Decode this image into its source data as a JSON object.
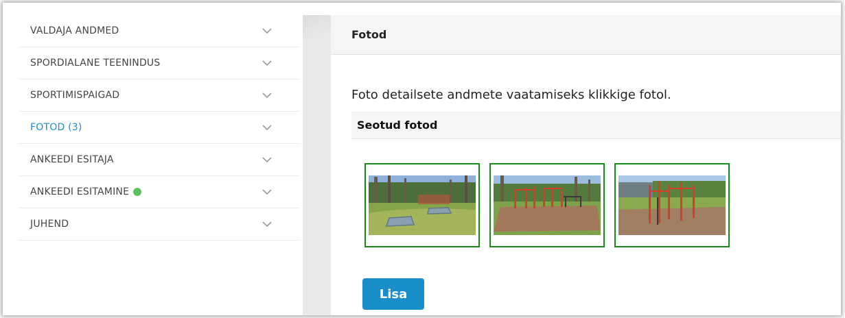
{
  "sidebar": {
    "items": [
      {
        "label": "VALDAJA ANDMED"
      },
      {
        "label": "SPORDIALANE TEENINDUS"
      },
      {
        "label": "SPORTIMISPAIGAD"
      },
      {
        "label": "FOTOD (3)",
        "active": true
      },
      {
        "label": "ANKEEDI ESITAJA"
      },
      {
        "label": "ANKEEDI ESITAMINE",
        "status_dot": "green"
      },
      {
        "label": "JUHEND"
      }
    ]
  },
  "main": {
    "title": "Fotod",
    "info_text": "Foto detailsete andmete vaatamiseks klikkige fotol.",
    "section_title": "Seotud fotod",
    "photo_count": 3,
    "add_button_label": "Lisa"
  },
  "colors": {
    "accent": "#1a8ec9",
    "photo_border": "#1a8a1a",
    "status_green": "#5cc35c"
  },
  "icons": {
    "sidebar_toggle": "chevron-down-icon"
  }
}
